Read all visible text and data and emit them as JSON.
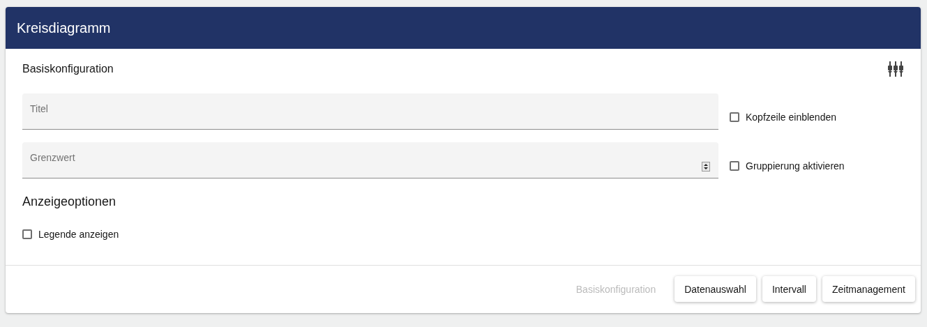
{
  "window": {
    "title": "Kreisdiagramm"
  },
  "basic": {
    "heading": "Basiskonfiguration",
    "rows": [
      {
        "field": {
          "kind": "text",
          "placeholder": "Titel"
        },
        "checkbox": {
          "label": "Kopfzeile einblenden",
          "checked": false
        }
      },
      {
        "field": {
          "kind": "number",
          "placeholder": "Grenzwert"
        },
        "checkbox": {
          "label": "Gruppierung aktivieren",
          "checked": false
        }
      }
    ]
  },
  "display": {
    "heading": "Anzeigeoptionen",
    "checkboxes": [
      {
        "label": "Legende anzeigen",
        "checked": false
      }
    ]
  },
  "footer": {
    "buttons": [
      {
        "label": "Basiskonfiguration",
        "disabled": true
      },
      {
        "label": "Datenauswahl",
        "disabled": false
      },
      {
        "label": "Intervall",
        "disabled": false
      },
      {
        "label": "Zeitmanagement",
        "disabled": false
      }
    ]
  }
}
